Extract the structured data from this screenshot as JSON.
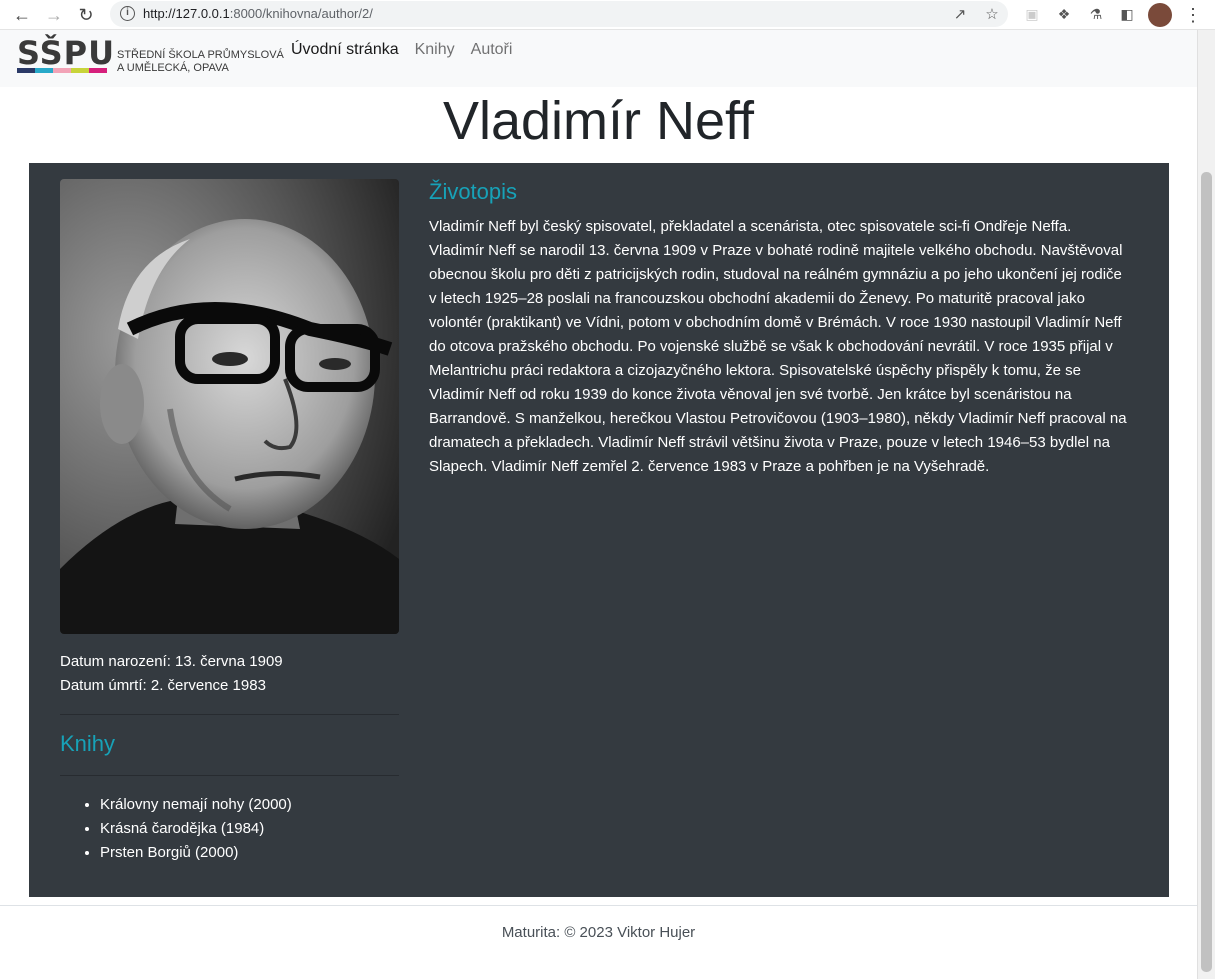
{
  "browser": {
    "url_scheme_host": "http://127.0.0.1",
    "url_rest": ":8000/knihovna/author/2/"
  },
  "site": {
    "logo_mark": "SŠPU",
    "logo_line1": "STŘEDNÍ ŠKOLA PRŮMYSLOVÁ",
    "logo_line2": "A UMĚLECKÁ, OPAVA",
    "logo_colors": [
      "#2b3a67",
      "#28a9c9",
      "#f2a3b7",
      "#c8d43a",
      "#d61f7c"
    ],
    "nav": [
      {
        "label": "Úvodní stránka",
        "active": true
      },
      {
        "label": "Knihy",
        "active": false
      },
      {
        "label": "Autoři",
        "active": false
      }
    ]
  },
  "author": {
    "first_name": "Vladimír",
    "last_name": "Neff",
    "birth_label": "Datum narození: 13. června 1909",
    "death_label": "Datum úmrtí: 2. července 1983"
  },
  "books": {
    "heading": "Knihy",
    "items": [
      "Královny nemají nohy (2000)",
      "Krásná čarodějka (1984)",
      "Prsten Borgiů (2000)"
    ]
  },
  "bio": {
    "heading": "Životopis",
    "text": "Vladimír Neff byl český spisovatel, překladatel a scenárista, otec spisovatele sci-fi Ondřeje Neffa. Vladimír Neff se narodil 13. června 1909 v Praze v bohaté rodině majitele velkého obchodu. Navštěvoval obecnou školu pro děti z patricijských rodin, studoval na reálném gymnáziu a po jeho ukončení jej rodiče v letech 1925–28 poslali na francouzskou obchodní akademii do Ženevy. Po maturitě pracoval jako volontér (praktikant) ve Vídni, potom v obchodním domě v Brémách. V roce 1930 nastoupil Vladimír Neff do otcova pražského obchodu. Po vojenské službě se však k obchodování nevrátil. V roce 1935 přijal v Melantrichu práci redaktora a cizojazyčného lektora. Spisovatelské úspěchy přispěly k tomu, že se Vladimír Neff od roku 1939 do konce života věnoval jen své tvorbě. Jen krátce byl scenáristou na Barrandově. S manželkou, herečkou Vlastou Petrovičovou (1903–1980), někdy Vladimír Neff pracoval na dramatech a překladech. Vladimír Neff strávil většinu života v Praze, pouze v letech 1946–53 bydlel na Slapech. Vladimír Neff zemřel 2. července 1983 v Praze a pohřben je na Vyšehradě."
  },
  "footer": {
    "text": "Maturita: © 2023 Viktor Hujer"
  },
  "colors": {
    "panel_bg": "#343a40",
    "heading_accent": "#17a2b8",
    "navbar_bg": "#f8f9fa"
  }
}
